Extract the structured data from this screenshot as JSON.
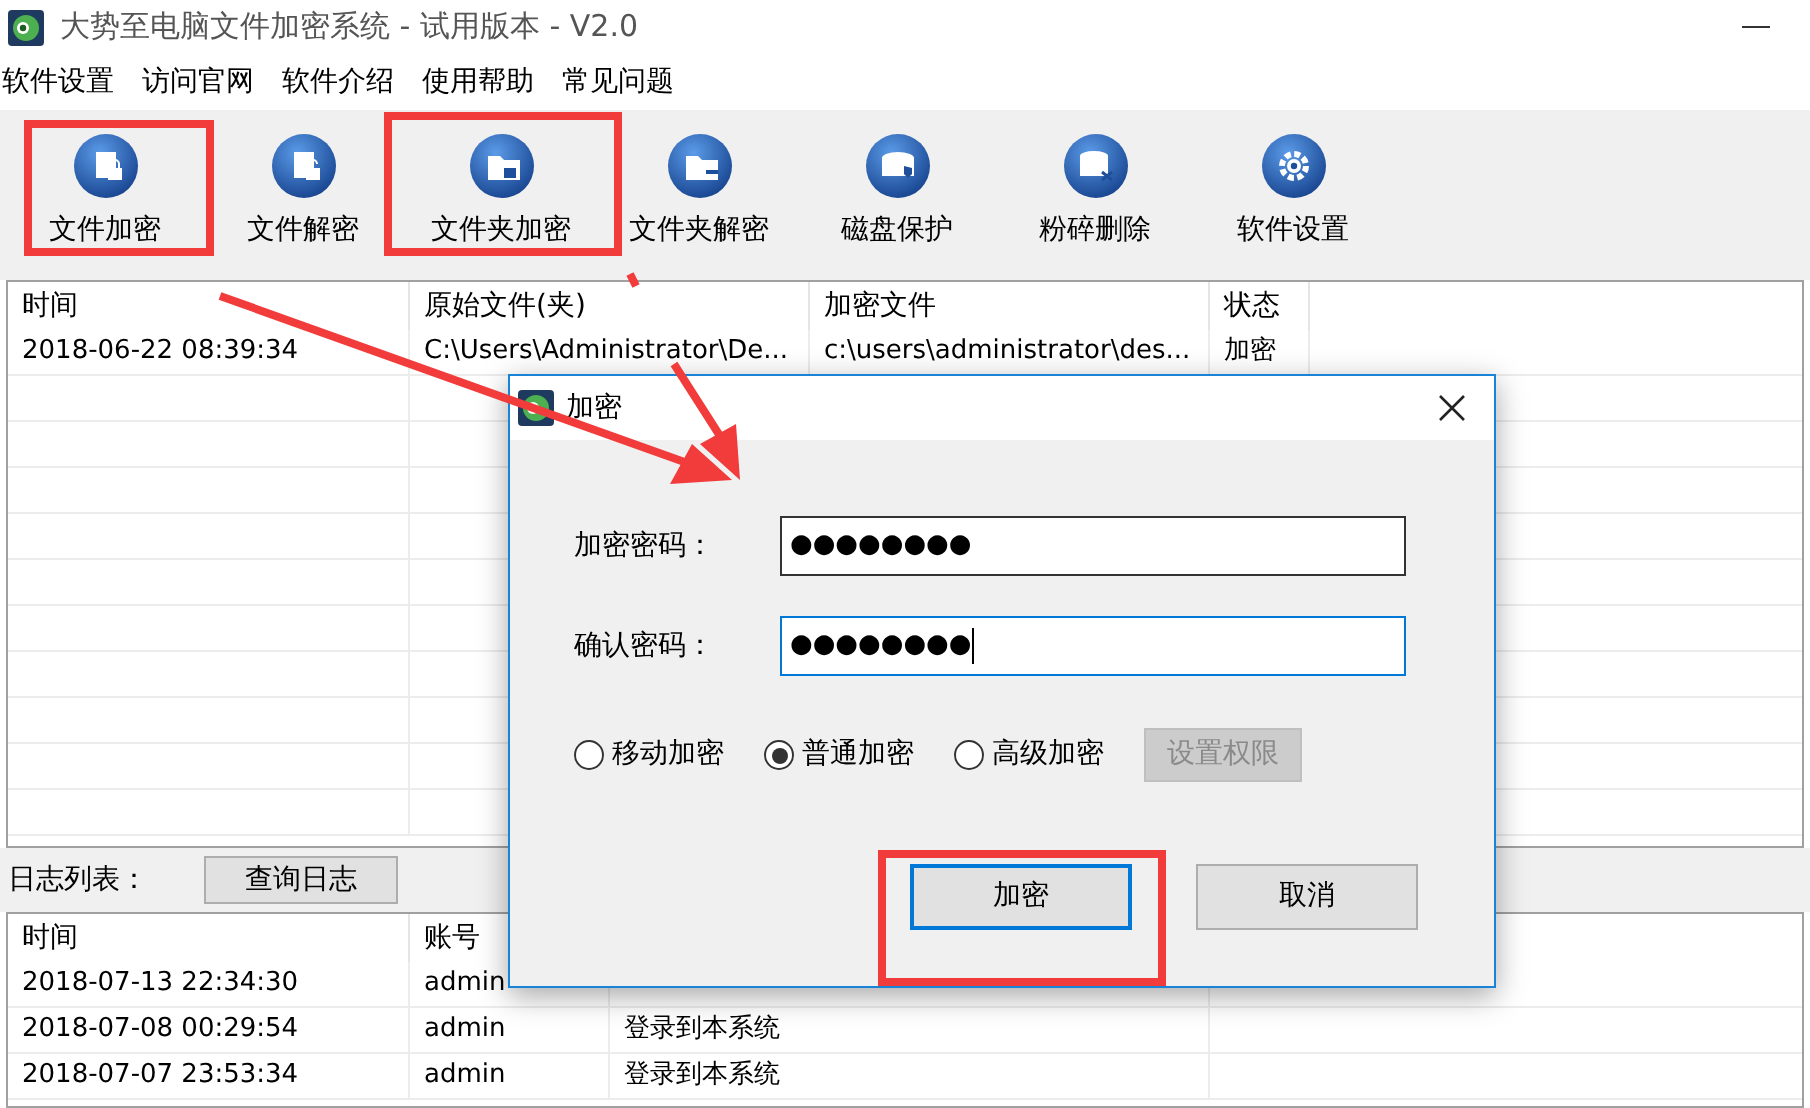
{
  "window": {
    "title": "大势至电脑文件加密系统 - 试用版本 - V2.0"
  },
  "menu": [
    "软件设置",
    "访问官网",
    "软件介绍",
    "使用帮助",
    "常见问题"
  ],
  "toolbar": [
    {
      "label": "文件加密",
      "kind": "file-lock"
    },
    {
      "label": "文件解密",
      "kind": "file-unlock"
    },
    {
      "label": "文件夹加密",
      "kind": "folder-lock"
    },
    {
      "label": "文件夹解密",
      "kind": "folder-unlock"
    },
    {
      "label": "磁盘保护",
      "kind": "disk"
    },
    {
      "label": "粉碎删除",
      "kind": "shred"
    },
    {
      "label": "软件设置",
      "kind": "gear"
    }
  ],
  "file_table": {
    "columns": [
      "时间",
      "原始文件(夹)",
      "加密文件",
      "状态"
    ],
    "rows": [
      [
        "2018-06-22 08:39:34",
        "C:\\Users\\Administrator\\De...",
        "c:\\users\\administrator\\des...",
        "加密"
      ]
    ]
  },
  "log": {
    "label": "日志列表：",
    "query_button": "查询日志",
    "columns": [
      "时间",
      "账号"
    ],
    "rows": [
      [
        "2018-07-13 22:34:30",
        "admin"
      ],
      [
        "2018-07-08 00:29:54",
        "admin",
        "登录到本系统"
      ],
      [
        "2018-07-07 23:53:34",
        "admin",
        "登录到本系统"
      ]
    ]
  },
  "dialog": {
    "title": "加密",
    "fields": [
      {
        "label": "加密密码：",
        "value": "●●●●●●●●",
        "focused": false
      },
      {
        "label": "确认密码：",
        "value": "●●●●●●●●",
        "focused": true
      }
    ],
    "modes": [
      {
        "label": "移动加密",
        "selected": false
      },
      {
        "label": "普通加密",
        "selected": true
      },
      {
        "label": "高级加密",
        "selected": false
      }
    ],
    "permission_button": {
      "label": "设置权限",
      "disabled": true
    },
    "ok_button": "加密",
    "cancel_button": "取消"
  }
}
